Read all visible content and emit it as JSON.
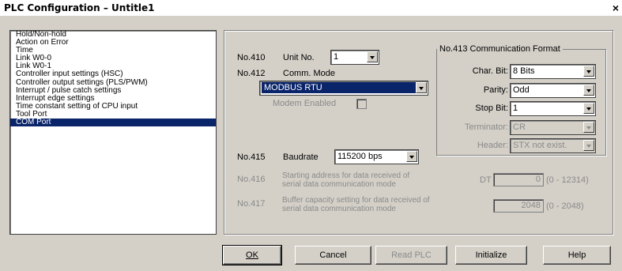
{
  "window": {
    "title": "PLC Configuration – Untitle1",
    "close": "×"
  },
  "sidebar": {
    "items": [
      "Hold/Non-hold",
      "Action on Error",
      "Time",
      "Link W0-0",
      "Link W0-1",
      "Controller input settings (HSC)",
      "Controller output settings (PLS/PWM)",
      "Interrupt / pulse catch settings",
      "Interrupt edge settings",
      "Time constant setting of CPU input",
      "Tool Port",
      "COM Port"
    ],
    "selected": "COM Port"
  },
  "com": {
    "no410": "No.410",
    "unit_no_label": "Unit No.",
    "unit_no_value": "1",
    "no412": "No.412",
    "comm_mode_label": "Comm. Mode",
    "comm_mode_value": "MODBUS RTU",
    "modem_label": "Modem Enabled",
    "no415": "No.415",
    "baudrate_label": "Baudrate",
    "baudrate_value": "115200 bps",
    "no416": "No.416",
    "no416_line1": "Starting address for data received of",
    "no416_line2": "serial data communication mode",
    "dt_label": "DT",
    "dt_value": "0",
    "dt_range": "(0 - 12314)",
    "no417": "No.417",
    "no417_line1": "Buffer capacity setting for data received of",
    "no417_line2": "serial data communication mode",
    "buf_value": "2048",
    "buf_range": "(0 - 2048)"
  },
  "format": {
    "legend": "No.413 Communication Format",
    "char_bit_label": "Char. Bit:",
    "char_bit_value": "8 Bits",
    "parity_label": "Parity:",
    "parity_value": "Odd",
    "stop_bit_label": "Stop Bit:",
    "stop_bit_value": "1",
    "terminator_label": "Terminator:",
    "terminator_value": "CR",
    "header_label": "Header:",
    "header_value": "STX not exist."
  },
  "buttons": {
    "ok": "OK",
    "cancel": "Cancel",
    "read_plc": "Read PLC",
    "initialize": "Initialize",
    "help": "Help"
  },
  "colors": {
    "selection": "#0a246a",
    "dialog_bg": "#d4d0c8",
    "disabled_text": "#8a8a8a"
  }
}
